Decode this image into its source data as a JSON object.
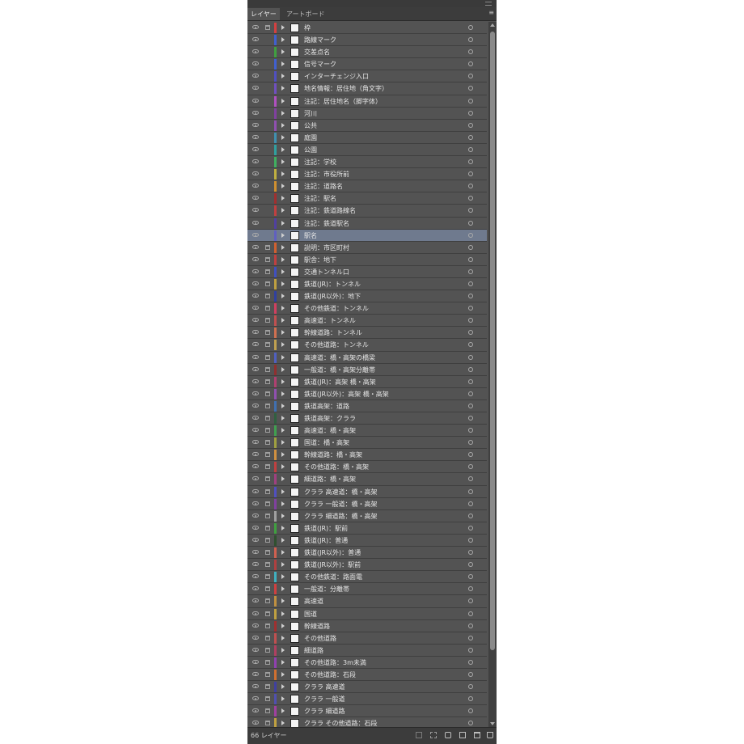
{
  "tabs": [
    {
      "label": "レイヤー"
    },
    {
      "label": "アートボード"
    }
  ],
  "footer": {
    "layer_count_label": "66 レイヤー"
  },
  "colors": {
    "panel_bg": "#535353",
    "selected_row": "#6f7a8e"
  },
  "layers": [
    {
      "name": "枠",
      "color": "#d44040",
      "locked": true
    },
    {
      "name": "路線マーク",
      "color": "#4060d0",
      "locked": false
    },
    {
      "name": "交差点名",
      "color": "#40a040",
      "locked": false
    },
    {
      "name": "信号マーク",
      "color": "#4060d0",
      "locked": false
    },
    {
      "name": "インターチェンジ入口",
      "color": "#5050c0",
      "locked": false
    },
    {
      "name": "地名情報：居住地（角文字）",
      "color": "#7050c0",
      "locked": false
    },
    {
      "name": "注記：居住地名（脚字体）",
      "color": "#b050c0",
      "locked": false
    },
    {
      "name": "河川",
      "color": "#8040a0",
      "locked": false
    },
    {
      "name": "公共",
      "color": "#9050b0",
      "locked": false
    },
    {
      "name": "庭園",
      "color": "#4090b0",
      "locked": false
    },
    {
      "name": "公園",
      "color": "#30a0a0",
      "locked": false
    },
    {
      "name": "注記：学校",
      "color": "#40b060",
      "locked": false
    },
    {
      "name": "注記：市役所前",
      "color": "#c0b040",
      "locked": false
    },
    {
      "name": "注記：道路名",
      "color": "#d09030",
      "locked": false
    },
    {
      "name": "注記：駅名",
      "color": "#a03030",
      "locked": false
    },
    {
      "name": "注記：鉄道路線名",
      "color": "#c04040",
      "locked": false
    },
    {
      "name": "注記：鉄道駅名",
      "color": "#5040a0",
      "locked": false
    },
    {
      "name": "駅名",
      "color": "#6060c0",
      "locked": false,
      "selected": true
    },
    {
      "name": "説明：市区町村",
      "color": "#d06030",
      "locked": true
    },
    {
      "name": "駅舎：地下",
      "color": "#c04040",
      "locked": true
    },
    {
      "name": "交通トンネル口",
      "color": "#4050c0",
      "locked": true
    },
    {
      "name": "鉄道(JR)：トンネル",
      "color": "#c0a040",
      "locked": true
    },
    {
      "name": "鉄道(JR以外)：地下",
      "color": "#3040a0",
      "locked": true
    },
    {
      "name": "その他鉄道：トンネル",
      "color": "#d04060",
      "locked": true
    },
    {
      "name": "高速道：トンネル",
      "color": "#c05050",
      "locked": true
    },
    {
      "name": "幹線道路：トンネル",
      "color": "#d07050",
      "locked": true
    },
    {
      "name": "その他道路：トンネル",
      "color": "#c0a050",
      "locked": true
    },
    {
      "name": "高速道：橋・高架の橋梁",
      "color": "#5060c0",
      "locked": true
    },
    {
      "name": "一般道：橋・高架分離帯",
      "color": "#903030",
      "locked": true
    },
    {
      "name": "鉄道(JR)：高架 橋・高架",
      "color": "#b04070",
      "locked": true
    },
    {
      "name": "鉄道(JR以外)：高架 橋・高架",
      "color": "#9050b0",
      "locked": true
    },
    {
      "name": "鉄道高架：道路",
      "color": "#4070b0",
      "locked": true
    },
    {
      "name": "鉄道高架：クララ",
      "color": "#306040",
      "locked": true
    },
    {
      "name": "高速道：橋・高架",
      "color": "#40a050",
      "locked": true
    },
    {
      "name": "国道：橋・高架",
      "color": "#a0a040",
      "locked": true
    },
    {
      "name": "幹線道路：橋・高架",
      "color": "#d09040",
      "locked": true
    },
    {
      "name": "その他道路：橋・高架",
      "color": "#c04040",
      "locked": true
    },
    {
      "name": "細道路：橋・高架",
      "color": "#a04080",
      "locked": true
    },
    {
      "name": "クララ 高速道：橋・高架",
      "color": "#5050c0",
      "locked": true
    },
    {
      "name": "クララ 一般道：橋・高架",
      "color": "#8040a0",
      "locked": true
    },
    {
      "name": "クララ 細道路：橋・高架",
      "color": "#a0a0a0",
      "locked": true
    },
    {
      "name": "鉄道(JR)：駅前",
      "color": "#40a040",
      "locked": true
    },
    {
      "name": "鉄道(JR)：普通",
      "color": "#305030",
      "locked": true
    },
    {
      "name": "鉄道(JR以外)：普通",
      "color": "#d06050",
      "locked": true
    },
    {
      "name": "鉄道(JR以外)：駅前",
      "color": "#b04040",
      "locked": true
    },
    {
      "name": "その他鉄道：路面電",
      "color": "#40b0c0",
      "locked": true
    },
    {
      "name": "一般道：分離帯",
      "color": "#d04040",
      "locked": true
    },
    {
      "name": "高速道",
      "color": "#c09040",
      "locked": true
    },
    {
      "name": "国道",
      "color": "#c0a040",
      "locked": true
    },
    {
      "name": "幹線道路",
      "color": "#a03030",
      "locked": true
    },
    {
      "name": "その他道路",
      "color": "#c05050",
      "locked": true
    },
    {
      "name": "細道路",
      "color": "#b04060",
      "locked": true
    },
    {
      "name": "その他道路：3m未満",
      "color": "#9040b0",
      "locked": true
    },
    {
      "name": "その他道路：石段",
      "color": "#d07030",
      "locked": true
    },
    {
      "name": "クララ 高速道",
      "color": "#4040a0",
      "locked": true
    },
    {
      "name": "クララ 一般道",
      "color": "#5050b0",
      "locked": true
    },
    {
      "name": "クララ 細道路",
      "color": "#a040a0",
      "locked": true
    },
    {
      "name": "クララ その他道路：石段",
      "color": "#c0a040",
      "locked": true
    }
  ]
}
